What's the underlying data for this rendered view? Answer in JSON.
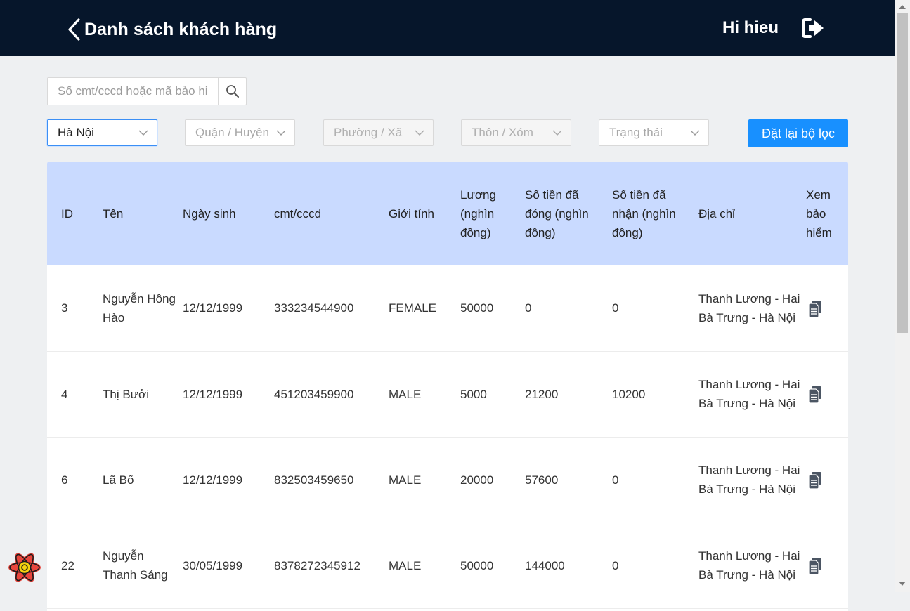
{
  "header": {
    "title": "Danh sách khách hàng",
    "greeting": "Hi hieu",
    "back_icon": "chevron-left-icon",
    "logout_icon": "sign-out-icon"
  },
  "search": {
    "placeholder": "Số cmt/cccd hoặc mã bảo hiểm",
    "value": "",
    "icon": "search-icon"
  },
  "filters": {
    "province": "Hà Nội",
    "district": "Quận / Huyện",
    "ward": "Phường / Xã",
    "village": "Thôn / Xóm",
    "status": "Trạng thái",
    "reset_label": "Đặt lại bộ lọc"
  },
  "table": {
    "headers": {
      "id": "ID",
      "name": "Tên",
      "dob": "Ngày sinh",
      "idcard": "cmt/cccd",
      "gender": "Giới tính",
      "salary": "Lương (nghìn đồng)",
      "paid": "Số tiền đã đóng (nghìn đồng)",
      "received": "Số tiền đã nhận (nghìn đồng)",
      "address": "Địa chỉ",
      "view": "Xem bảo hiểm"
    },
    "rows": [
      {
        "id": "3",
        "name": "Nguyễn Hồng Hào",
        "dob": "12/12/1999",
        "idcard": "333234544900",
        "gender": "FEMALE",
        "salary": "50000",
        "paid": "0",
        "received": "0",
        "address": "Thanh Lương - Hai Bà Trưng - Hà Nội"
      },
      {
        "id": "4",
        "name": "Thị Bưởi",
        "dob": "12/12/1999",
        "idcard": "451203459900",
        "gender": "MALE",
        "salary": "5000",
        "paid": "21200",
        "received": "10200",
        "address": "Thanh Lương - Hai Bà Trưng - Hà Nội"
      },
      {
        "id": "6",
        "name": "Lã Bố",
        "dob": "12/12/1999",
        "idcard": "832503459650",
        "gender": "MALE",
        "salary": "20000",
        "paid": "57600",
        "received": "0",
        "address": "Thanh Lương - Hai Bà Trưng - Hà Nội"
      },
      {
        "id": "22",
        "name": "Nguyễn Thanh Sáng",
        "dob": "30/05/1999",
        "idcard": "8378272345912",
        "gender": "MALE",
        "salary": "50000",
        "paid": "144000",
        "received": "0",
        "address": "Thanh Lương - Hai Bà Trưng - Hà Nội"
      }
    ]
  },
  "colors": {
    "header_bg": "#06162b",
    "table_header_bg": "#c9daff",
    "accent": "#1890ff",
    "page_bg": "#eef0f2"
  }
}
